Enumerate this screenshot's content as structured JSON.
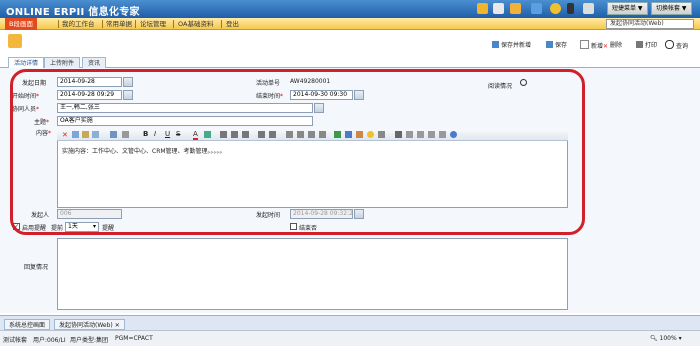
{
  "header": {
    "logo": "ONLINE ERPII 信息化专家",
    "shortcut_menu_label": "短捷菜单 ▼",
    "switch_module_label": "切换帐套 ▼"
  },
  "menu": {
    "items": [
      "B段画面",
      "我的工作台",
      "常用单据",
      "论坛管理",
      "OA基础资料",
      "登出"
    ],
    "right_select": "发起协同活动(Web)"
  },
  "toolbar": {
    "save_new": "保存并新增",
    "save": "保存",
    "new": "新增",
    "delete": "删除",
    "print": "打印",
    "query": "查询"
  },
  "tabs": [
    "活动详情",
    "上传附件",
    "资讯"
  ],
  "form": {
    "start_date_label": "发起日期",
    "start_date_value": "2014-09-28",
    "activity_no_label": "活动单号",
    "activity_no_value": "AW49280001",
    "read_status_label": "阅读情况",
    "begin_time_label": "开始时间",
    "begin_time_value": "2014-09-28 09:29",
    "end_time_label": "结束时间",
    "end_time_value": "2014-09-30 09:30",
    "participants_label": "协同人员",
    "participants_value": "王一,韩二,张三",
    "subject_label": "主题",
    "subject_value": "OA客户实施",
    "content_label": "内容",
    "content_value": "实施内容：工作中心、文管中心、CRM管理、考勤管理。。。。。",
    "initiator_label": "发起人",
    "initiator_value": "006",
    "init_time_label": "发起时间",
    "init_time_value": "2014-09-28 09:32:22",
    "reminder_label": "启用提醒",
    "advance_label": "提前",
    "advance_value": "1天",
    "remind_label": "提醒",
    "conclusion_label": "结束否",
    "reply_label": "回复情况"
  },
  "bottom_tabs": [
    "系统总控画面",
    "发起协同活动(Web)"
  ],
  "status_bar": {
    "test_label": "测试帐套",
    "user": "用户:006/LI",
    "user_type": "用户类型:集团",
    "pgm": "PGM=CPACT",
    "zoom": "100%"
  },
  "colors": {
    "header_blue": "#2a6ab7",
    "menu_yellow": "#f5c84a",
    "highlight_red": "#d2202a"
  }
}
